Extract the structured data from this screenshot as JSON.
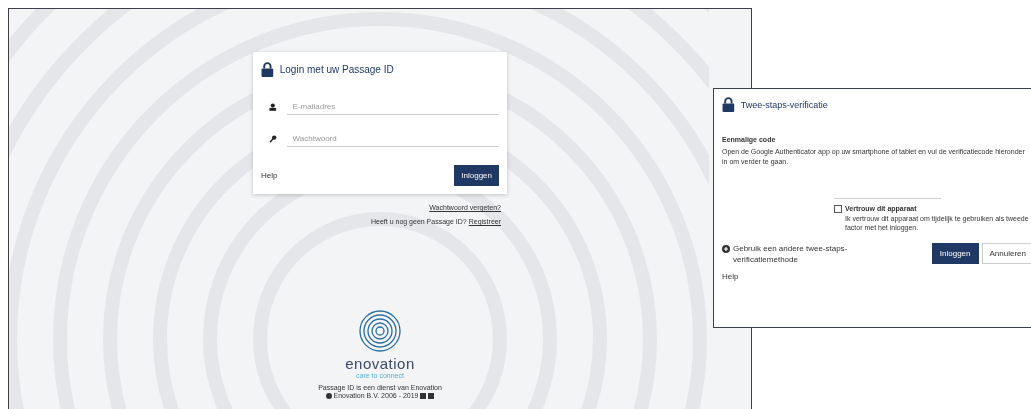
{
  "login": {
    "title": "Login met uw Passage ID",
    "fields": [
      {
        "kind": "email",
        "placeholder": "E-mailadres"
      },
      {
        "kind": "password",
        "placeholder": "Wachtwoord"
      }
    ],
    "help": "Help",
    "submit": "Inloggen"
  },
  "links": {
    "forgot": "Wachtwoord vergeten?",
    "no_account": "Heeft u nog geen Passage ID?",
    "register": "Registreer"
  },
  "brand": {
    "name": "enovation",
    "tagline": "care to connect"
  },
  "footer": {
    "service": "Passage ID is een dienst van Enovation",
    "copyright": "Enovation B.V. 2006 - 2019"
  },
  "two_step": {
    "title": "Twee-staps-verificatie",
    "heading": "Eenmalige code",
    "instructions": "Open de Google Authenticator app op uw smartphone of tablet en vul de verificatiecode hieronder in om verder te gaan.",
    "trust": {
      "label": "Vertrouw dit apparaat",
      "description": "Ik vertrouw dit apparaat om tijdelijk te gebruiken als tweede factor met het inloggen.",
      "checked": false
    },
    "other_method": "Gebruik een andere twee-staps-verificatiemethode",
    "submit": "Inloggen",
    "cancel": "Annuleren",
    "help": "Help"
  }
}
